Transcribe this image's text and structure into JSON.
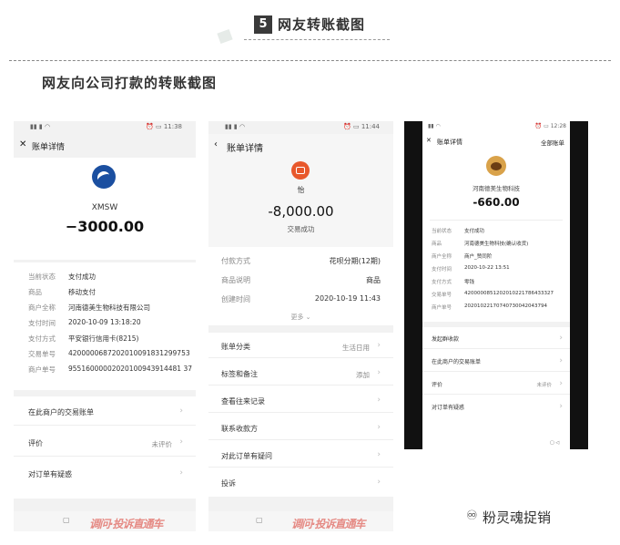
{
  "header": {
    "section_number": "5",
    "section_title": "网友转账截图",
    "subtitle": "网友向公司打款的转账截图"
  },
  "brand": {
    "name": "粉灵魂捉销"
  },
  "watermark": "调问·投诉直通车",
  "phone1": {
    "time": "11:38",
    "nav_title": "账单详情",
    "merchant": "XMSW",
    "amount": "−3000.00",
    "details": [
      {
        "label": "当前状态",
        "value": "支付成功"
      },
      {
        "label": "商品",
        "value": "移动支付"
      },
      {
        "label": "商户全称",
        "value": "河南德美生物科技有限公司"
      },
      {
        "label": "支付时间",
        "value": "2020-10-09 13:18:20"
      },
      {
        "label": "支付方式",
        "value": "平安银行信用卡(8215)"
      },
      {
        "label": "交易单号",
        "value": "4200000687202010091831299753"
      },
      {
        "label": "商户单号",
        "value": "95516000002020100943914481 37"
      }
    ],
    "actions": [
      {
        "label": "在此商户的交易账单",
        "hint": ""
      },
      {
        "label": "评价",
        "hint": "未评价"
      },
      {
        "label": "对订单有疑惑",
        "hint": ""
      }
    ]
  },
  "phone2": {
    "time": "11:44",
    "nav_title": "账单详情",
    "merchant": "怡",
    "amount": "-8,000.00",
    "status": "交易成功",
    "details": [
      {
        "label": "付款方式",
        "value": "花呗分期(12期)"
      },
      {
        "label": "商品说明",
        "value": "商品"
      },
      {
        "label": "创建时间",
        "value": "2020-10-19 11:43"
      }
    ],
    "more": "更多",
    "actions": [
      {
        "label": "账单分类",
        "hint": "生活日用"
      },
      {
        "label": "标签和备注",
        "hint": "添加"
      },
      {
        "label": "查看往来记录",
        "hint": ""
      },
      {
        "label": "联系收款方",
        "hint": ""
      },
      {
        "label": "对此订单有疑问",
        "hint": ""
      },
      {
        "label": "投诉",
        "hint": ""
      }
    ]
  },
  "phone3": {
    "time": "12:28",
    "nav_title": "账单详情",
    "nav_right": "全部账单",
    "merchant": "河南德美生物科技",
    "amount": "-660.00",
    "details": [
      {
        "label": "当前状态",
        "value": "支付成功"
      },
      {
        "label": "商品",
        "value": "河南德美生物科技(确认收货)"
      },
      {
        "label": "商户全称",
        "value": "商户_赞同阶"
      },
      {
        "label": "支付时间",
        "value": "2020-10-22 13:51"
      },
      {
        "label": "支付方式",
        "value": "零钱"
      },
      {
        "label": "交易单号",
        "value": "4200000851202010221786433327"
      },
      {
        "label": "商户单号",
        "value": "20201022170740730042043794"
      }
    ],
    "actions": [
      {
        "label": "发起群收款",
        "hint": ""
      },
      {
        "label": "在此商户的交易账单",
        "hint": ""
      },
      {
        "label": "评价",
        "hint": "未评价"
      },
      {
        "label": "对订单有疑惑",
        "hint": ""
      }
    ]
  }
}
